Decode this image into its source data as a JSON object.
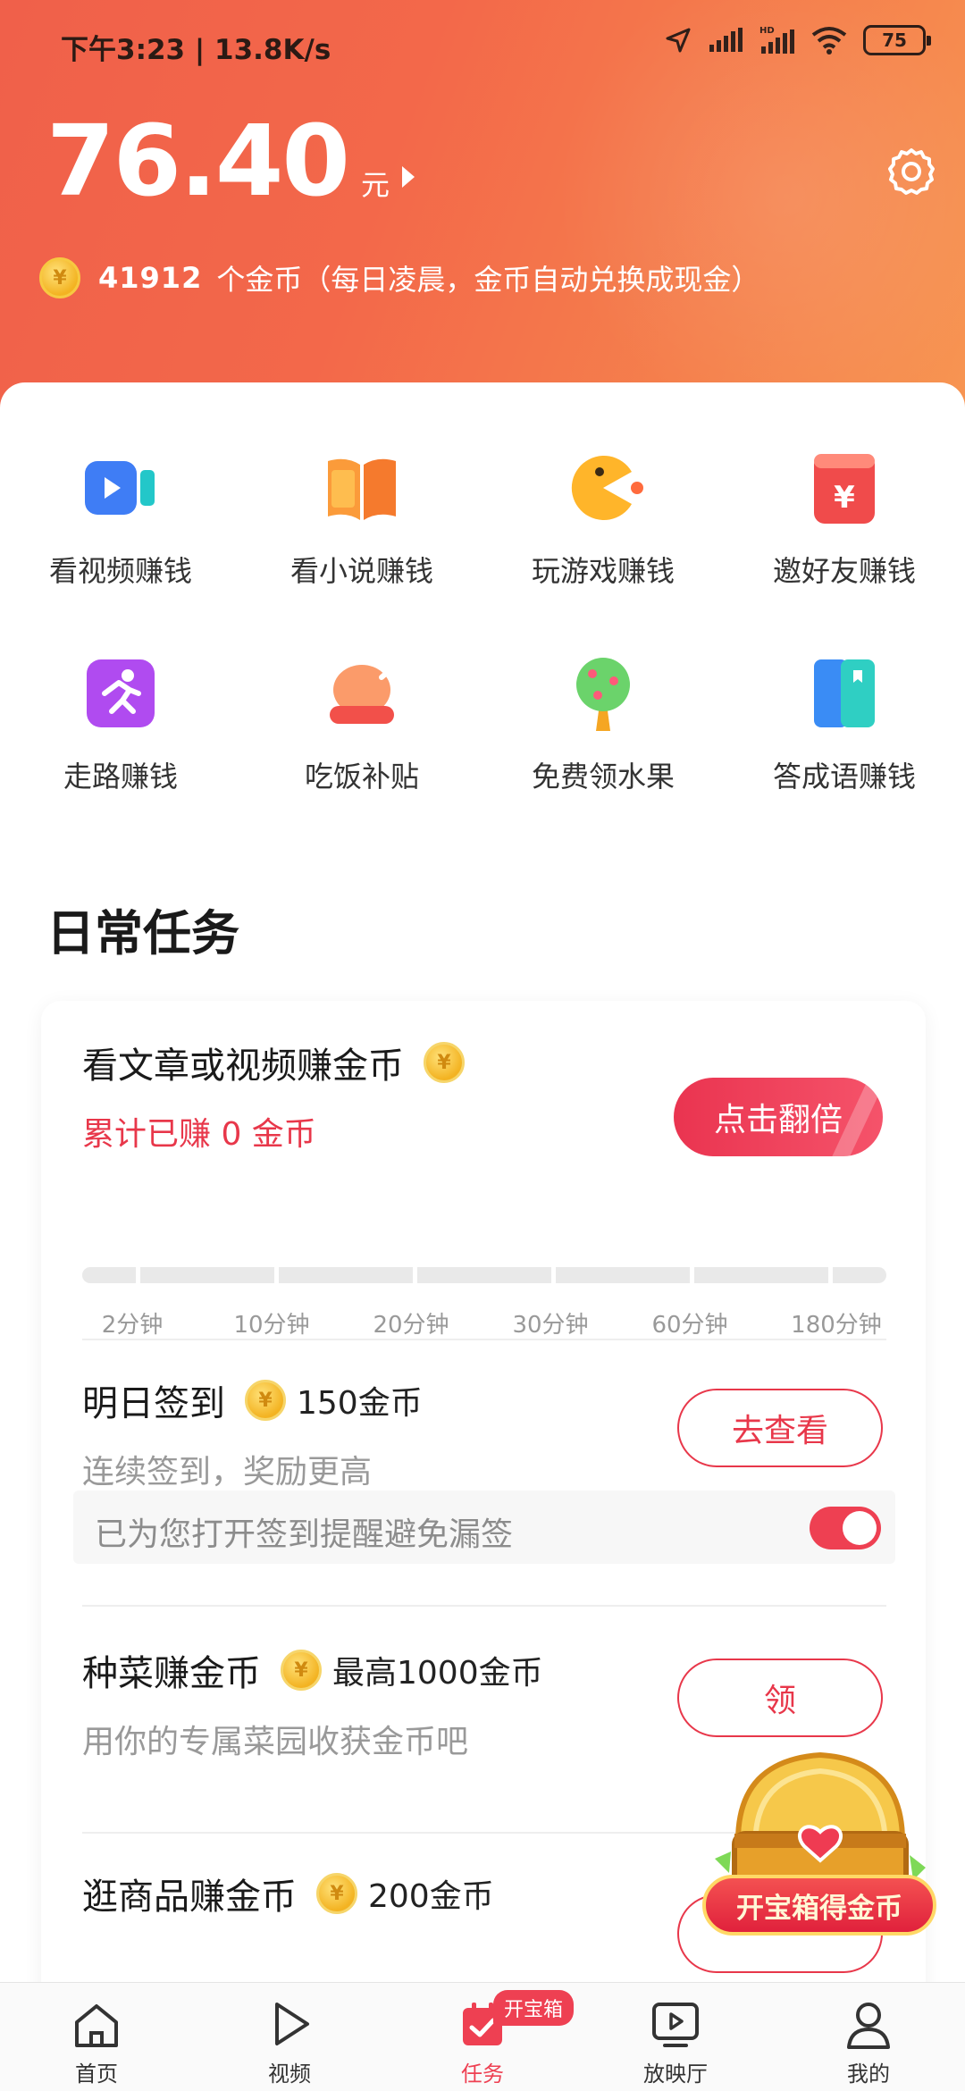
{
  "status_bar": {
    "time": "下午3:23 | 13.8K/s",
    "battery": "75"
  },
  "header": {
    "balance": "76.40",
    "balance_unit": "元",
    "coins_count": "41912",
    "coins_text": "个金币（每日凌晨，金币自动兑换成现金）",
    "colors": {
      "gradient_start": "#f0604a",
      "gradient_end": "#f79552"
    }
  },
  "earn_grid": [
    {
      "label": "看视频赚钱",
      "icon": "video-icon"
    },
    {
      "label": "看小说赚钱",
      "icon": "book-icon"
    },
    {
      "label": "玩游戏赚钱",
      "icon": "game-icon"
    },
    {
      "label": "邀好友赚钱",
      "icon": "red-envelope-icon"
    },
    {
      "label": "走路赚钱",
      "icon": "running-icon"
    },
    {
      "label": "吃饭补贴",
      "icon": "chicken-leg-icon"
    },
    {
      "label": "免费领水果",
      "icon": "fruit-tree-icon"
    },
    {
      "label": "答成语赚钱",
      "icon": "card-icon"
    }
  ],
  "daily_tasks": {
    "title": "日常任务",
    "watch": {
      "title": "看文章或视频赚金币",
      "subtitle": "累计已赚 0 金币",
      "button": "点击翻倍",
      "milestones": [
        "2分钟",
        "10分钟",
        "20分钟",
        "30分钟",
        "60分钟",
        "180分钟"
      ],
      "progress": 0
    },
    "checkin": {
      "title": "明日签到",
      "reward": "150金币",
      "subtitle": "连续签到，奖励更高",
      "button": "去查看",
      "reminder": "已为您打开签到提醒避免漏签",
      "reminder_on": true
    },
    "garden": {
      "title": "种菜赚金币",
      "reward": "最高1000金币",
      "subtitle": "用你的专属菜园收获金币吧",
      "button": "领"
    },
    "shopping": {
      "title": "逛商品赚金币",
      "reward": "200金币"
    }
  },
  "treasure": {
    "label": "开宝箱得金币"
  },
  "bottom_nav": {
    "items": [
      {
        "label": "首页",
        "icon": "home-icon"
      },
      {
        "label": "视频",
        "icon": "play-icon"
      },
      {
        "label": "任务",
        "icon": "task-icon",
        "badge": "开宝箱"
      },
      {
        "label": "放映厅",
        "icon": "theater-icon"
      },
      {
        "label": "我的",
        "icon": "profile-icon"
      }
    ],
    "active": "任务",
    "active_color": "#ee4052"
  }
}
